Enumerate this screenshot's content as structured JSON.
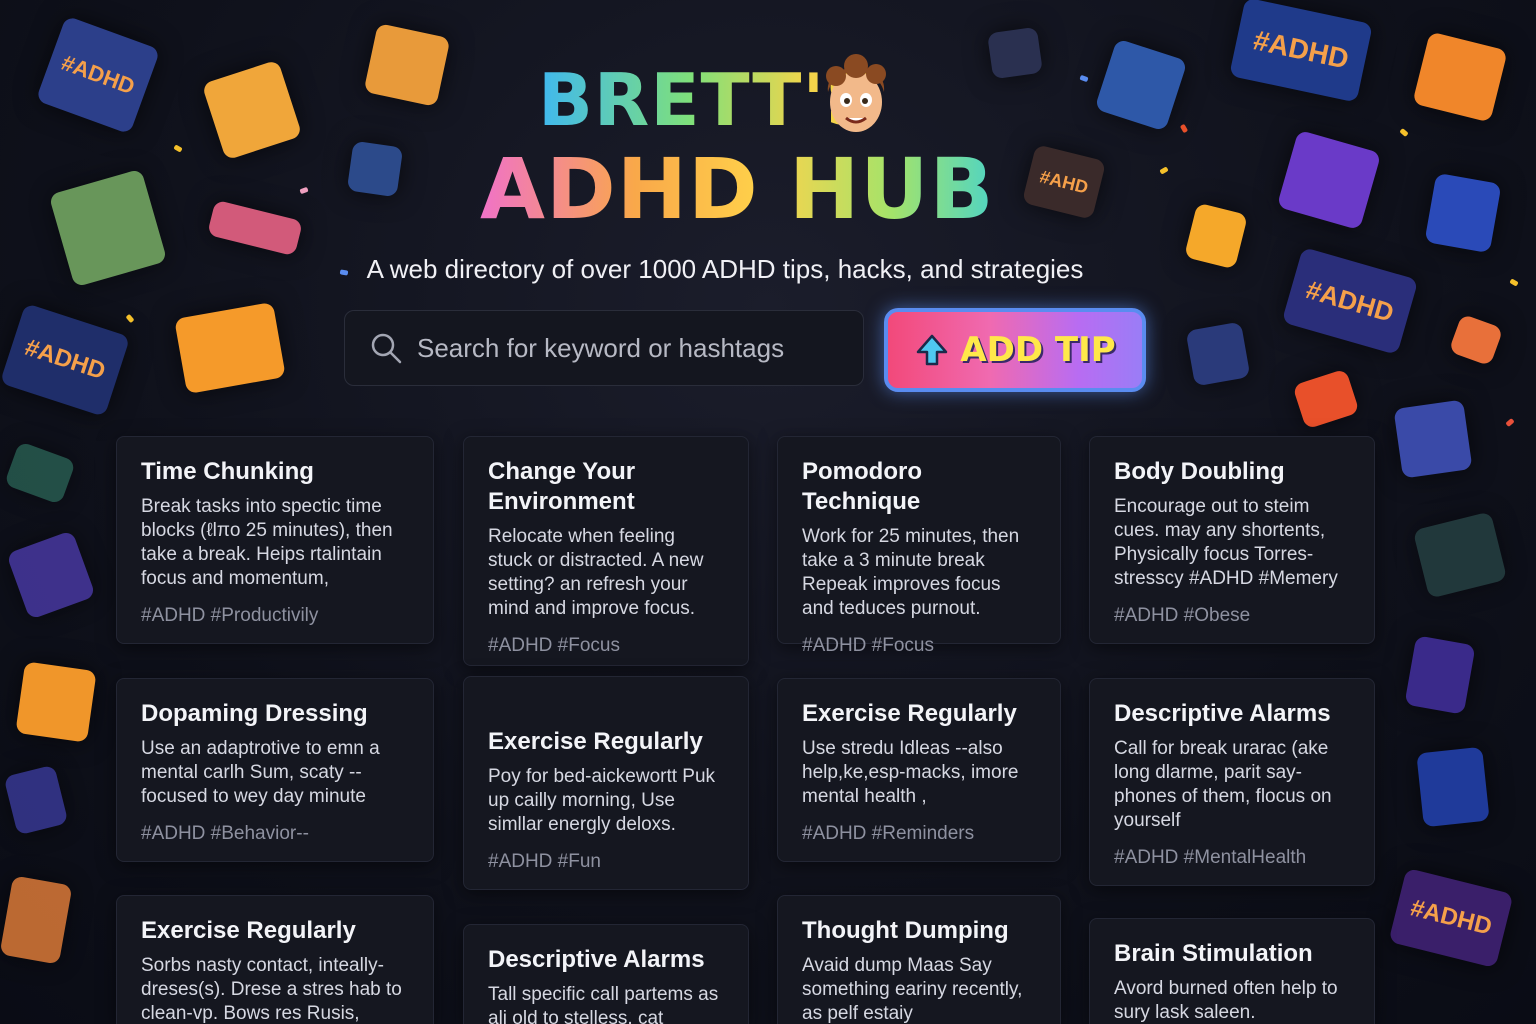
{
  "header": {
    "logo_line1": "BRETT'S",
    "logo_line2": "ADHD HUB",
    "subtitle": "A web directory of over 1000 ADHD tips, hacks, and strategies"
  },
  "search": {
    "placeholder": "Search for keyword or hashtags",
    "value": ""
  },
  "add_tip_button": {
    "label": "ADD TIP"
  },
  "decor_tags": [
    "#ADHD",
    "#ADHD",
    "#ADHD",
    "#ADHD",
    "#AHD",
    "#ADHD"
  ],
  "cards": [
    {
      "title": "Time Chunking",
      "body": "Break tasks into spectic time blocks (ℓlπo 25 minutes), then take a break. Heips rtalintain focus and momentum,",
      "tags": "#ADHD #Productivily"
    },
    {
      "title": "Change Your Environment",
      "body": "Relocate when feeling stuck or distracted. A new setting? an refresh your mind and improve focus.",
      "tags": "#ADHD #Focus"
    },
    {
      "title": "Pomodoro Technique",
      "body": "Work for 25 minutes, then take a 3 minute break Repeak improves focus and teduces purnout.",
      "tags": "#ADHD #Focus"
    },
    {
      "title": "Body Doubling",
      "body": "Encourage out to steim cues. may any shortents, Physically focus Torres-stresscy #ADHD #Memery",
      "tags": "#ADHD #Obese"
    },
    {
      "title": "Dopaming Dressing",
      "body": "Use an adaptrotive to emn a mental carlh Sum, scaty -- focused to wey day minute",
      "tags": "#ADHD #Behavior--"
    },
    {
      "title": "Exercise Regularly",
      "body": "Poy for bed-aickewortt Puk up cailly morning, Use simllar energly deloxs.",
      "tags": "#ADHD #Fun"
    },
    {
      "title": "Exercise Regularly",
      "body": "Use stredu Idleas --also help,ke,esp-macks, imore mental health ,",
      "tags": "#ADHD #Reminders"
    },
    {
      "title": "Descriptive Alarms",
      "body": "Call for break urarac (ake long dlarme, parit say-phones of them, flocus on yourself",
      "tags": "#ADHD #MentalHealth"
    },
    {
      "title": "Exercise Regularly",
      "body": "Sorbs nasty contact, inteally-dreses(s). Drese a stres hab to clean-vp. Bows res Rusis,",
      "tags": ""
    },
    {
      "title": "Descriptive Alarms",
      "body": "Tall specific call partems as ali old to stelless, cat",
      "tags": ""
    },
    {
      "title": "Thought Dumping",
      "body": "Avaid dump Maas Say something eariny recently, as pelf estaiy",
      "tags": ""
    },
    {
      "title": "Brain Stimulation",
      "body": "Avord burned often help to sury lask saleen.",
      "tags": ""
    }
  ],
  "colors": {
    "background": "#0f111b",
    "card_bg": "#151720",
    "button_border": "#5a8cf0",
    "button_label": "#ffe84a"
  },
  "icons": [
    "search-icon",
    "up-arrow-icon",
    "cartoon-avatar-icon"
  ]
}
